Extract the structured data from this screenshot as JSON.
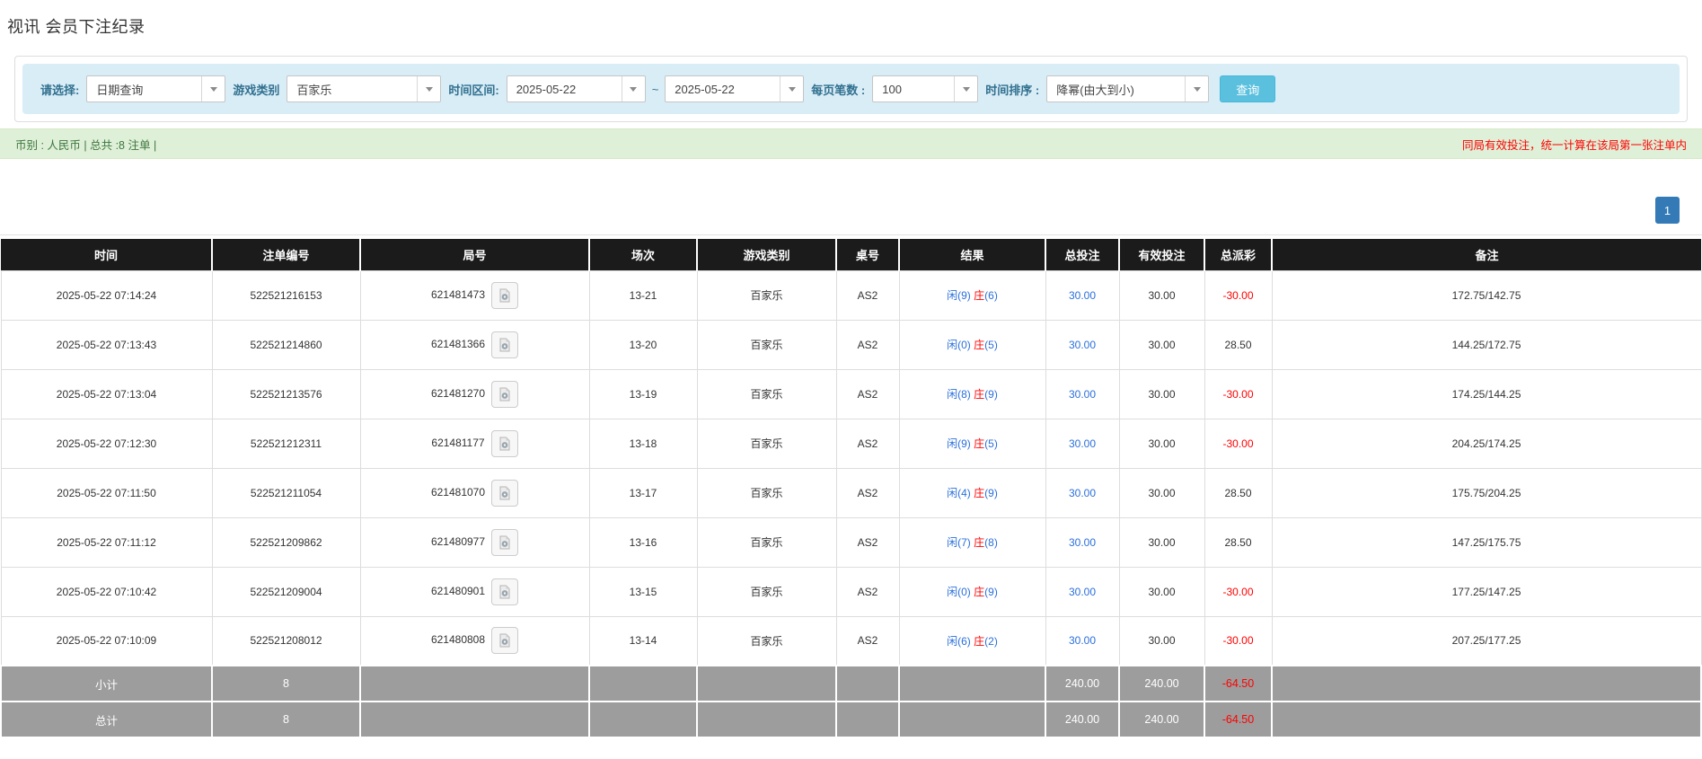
{
  "page_title": "视讯 会员下注纪录",
  "filter_bar": {
    "query_type_label": "请选择:",
    "query_type_value": "日期查询",
    "game_category_label": "游戏类别",
    "game_category_value": "百家乐",
    "date_range_label": "时间区间:",
    "date_from": "2025-05-22",
    "date_separator": "~",
    "date_to": "2025-05-22",
    "page_size_label": "每页笔数 :",
    "page_size_value": "100",
    "sort_label": "时间排序 :",
    "sort_value": "降幂(由大到小)",
    "search_button_label": "查询"
  },
  "summary_bar": {
    "left_text": "币别 : 人民币 | 总共 :8 注单 |",
    "right_note": "同局有效投注，统一计算在该局第一张注单内"
  },
  "pagination": {
    "current_page": "1"
  },
  "table": {
    "headers": [
      "时间",
      "注单编号",
      "局号",
      "场次",
      "游戏类别",
      "桌号",
      "结果",
      "总投注",
      "有效投注",
      "总派彩",
      "备注"
    ],
    "rows": [
      {
        "time": "2025-05-22 07:14:24",
        "bet_no": "522521216153",
        "round_no": "621481473",
        "session": "13-21",
        "game": "百家乐",
        "table_no": "AS2",
        "result_player": "闲(9)",
        "result_banker": "庄",
        "result_banker_num": "(6)",
        "total_bet": "30.00",
        "valid_bet": "30.00",
        "payout": "-30.00",
        "remark": "172.75/142.75"
      },
      {
        "time": "2025-05-22 07:13:43",
        "bet_no": "522521214860",
        "round_no": "621481366",
        "session": "13-20",
        "game": "百家乐",
        "table_no": "AS2",
        "result_player": "闲(0)",
        "result_banker": "庄",
        "result_banker_num": "(5)",
        "total_bet": "30.00",
        "valid_bet": "30.00",
        "payout": "28.50",
        "remark": "144.25/172.75"
      },
      {
        "time": "2025-05-22 07:13:04",
        "bet_no": "522521213576",
        "round_no": "621481270",
        "session": "13-19",
        "game": "百家乐",
        "table_no": "AS2",
        "result_player": "闲(8)",
        "result_banker": "庄",
        "result_banker_num": "(9)",
        "total_bet": "30.00",
        "valid_bet": "30.00",
        "payout": "-30.00",
        "remark": "174.25/144.25"
      },
      {
        "time": "2025-05-22 07:12:30",
        "bet_no": "522521212311",
        "round_no": "621481177",
        "session": "13-18",
        "game": "百家乐",
        "table_no": "AS2",
        "result_player": "闲(9)",
        "result_banker": "庄",
        "result_banker_num": "(5)",
        "total_bet": "30.00",
        "valid_bet": "30.00",
        "payout": "-30.00",
        "remark": "204.25/174.25"
      },
      {
        "time": "2025-05-22 07:11:50",
        "bet_no": "522521211054",
        "round_no": "621481070",
        "session": "13-17",
        "game": "百家乐",
        "table_no": "AS2",
        "result_player": "闲(4)",
        "result_banker": "庄",
        "result_banker_num": "(9)",
        "total_bet": "30.00",
        "valid_bet": "30.00",
        "payout": "28.50",
        "remark": "175.75/204.25"
      },
      {
        "time": "2025-05-22 07:11:12",
        "bet_no": "522521209862",
        "round_no": "621480977",
        "session": "13-16",
        "game": "百家乐",
        "table_no": "AS2",
        "result_player": "闲(7)",
        "result_banker": "庄",
        "result_banker_num": "(8)",
        "total_bet": "30.00",
        "valid_bet": "30.00",
        "payout": "28.50",
        "remark": "147.25/175.75"
      },
      {
        "time": "2025-05-22 07:10:42",
        "bet_no": "522521209004",
        "round_no": "621480901",
        "session": "13-15",
        "game": "百家乐",
        "table_no": "AS2",
        "result_player": "闲(0)",
        "result_banker": "庄",
        "result_banker_num": "(9)",
        "total_bet": "30.00",
        "valid_bet": "30.00",
        "payout": "-30.00",
        "remark": "177.25/147.25"
      },
      {
        "time": "2025-05-22 07:10:09",
        "bet_no": "522521208012",
        "round_no": "621480808",
        "session": "13-14",
        "game": "百家乐",
        "table_no": "AS2",
        "result_player": "闲(6)",
        "result_banker": "庄",
        "result_banker_num": "(2)",
        "total_bet": "30.00",
        "valid_bet": "30.00",
        "payout": "-30.00",
        "remark": "207.25/177.25"
      }
    ],
    "subtotal_row": {
      "label": "小计",
      "count": "8",
      "total_bet": "240.00",
      "valid_bet": "240.00",
      "payout": "-64.50"
    },
    "total_row": {
      "label": "总计",
      "count": "8",
      "total_bet": "240.00",
      "valid_bet": "240.00",
      "payout": "-64.50"
    }
  },
  "colors": {
    "accent_blue": "#2a6fdb",
    "banker_red": "#ff0000",
    "negative_red": "#ff0000",
    "search_button_bg": "#5bc0de",
    "pagination_active_bg": "#337ab7",
    "filter_bar_bg": "#d9edf7",
    "summary_bar_bg": "#dff0d8",
    "table_header_bg": "#1b1b1b",
    "footer_row_bg": "#9d9d9d"
  }
}
